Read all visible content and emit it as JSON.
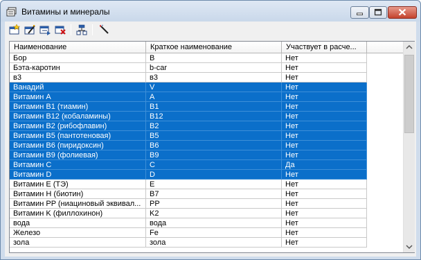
{
  "window": {
    "title": "Витамины и минералы"
  },
  "toolbar": {
    "buttons": [
      {
        "icon": "add-record-icon"
      },
      {
        "icon": "edit-record-icon"
      },
      {
        "icon": "copy-record-icon"
      },
      {
        "icon": "delete-record-icon"
      },
      {
        "icon": "tree-icon"
      },
      {
        "icon": "magic-wand-icon"
      }
    ]
  },
  "table": {
    "columns": [
      "Наименование",
      "Краткое наименование",
      "Участвует в расче..."
    ],
    "rows": [
      {
        "name": "Бор",
        "short": "B",
        "participates": "Нет",
        "selected": false
      },
      {
        "name": "Бэта-каротин",
        "short": "b-car",
        "participates": "Нет",
        "selected": false
      },
      {
        "name": "в3",
        "short": "в3",
        "participates": "Нет",
        "selected": false
      },
      {
        "name": "Ванадий",
        "short": "V",
        "participates": "Нет",
        "selected": true
      },
      {
        "name": "Витамин A",
        "short": "A",
        "participates": "Нет",
        "selected": true
      },
      {
        "name": "Витамин B1 (тиамин)",
        "short": "B1",
        "participates": "Нет",
        "selected": true
      },
      {
        "name": "Витамин B12 (кобаламины)",
        "short": "B12",
        "participates": "Нет",
        "selected": true
      },
      {
        "name": "Витамин B2 (рибофлавин)",
        "short": "B2",
        "participates": "Нет",
        "selected": true
      },
      {
        "name": "Витамин B5 (пантотеновая)",
        "short": "B5",
        "participates": "Нет",
        "selected": true
      },
      {
        "name": "Витамин B6 (пиридоксин)",
        "short": "B6",
        "participates": "Нет",
        "selected": true
      },
      {
        "name": "Витамин B9 (фолиевая)",
        "short": "B9",
        "participates": "Нет",
        "selected": true
      },
      {
        "name": "Витамин C",
        "short": "C",
        "participates": "Да",
        "selected": true
      },
      {
        "name": "Витамин D",
        "short": "D",
        "participates": "Нет",
        "selected": true
      },
      {
        "name": "Витамин E (ТЭ)",
        "short": "E",
        "participates": "Нет",
        "selected": false
      },
      {
        "name": "Витамин H (биотин)",
        "short": "B7",
        "participates": "Нет",
        "selected": false
      },
      {
        "name": "Витамин PP (ниациновый эквивал...",
        "short": "PP",
        "participates": "Нет",
        "selected": false
      },
      {
        "name": "Витамин K (филлохинон)",
        "short": "K2",
        "participates": "Нет",
        "selected": false
      },
      {
        "name": "вода",
        "short": "вода",
        "participates": "Нет",
        "selected": false
      },
      {
        "name": "Железо",
        "short": "Fe",
        "participates": "Нет",
        "selected": false
      },
      {
        "name": "зола",
        "short": "зола",
        "participates": "Нет",
        "selected": false
      }
    ]
  },
  "colors": {
    "selection": "#0b6fca",
    "close_button": "#c4432d"
  }
}
